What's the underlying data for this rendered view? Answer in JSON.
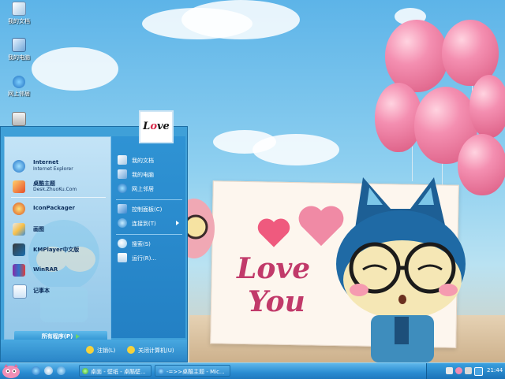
{
  "desktop_icons": [
    {
      "label": "我的文档",
      "icon": "my-documents-icon"
    },
    {
      "label": "我的电脑",
      "icon": "my-computer-icon"
    },
    {
      "label": "网上邻居",
      "icon": "network-icon"
    },
    {
      "label": "",
      "icon": "recycle-bin-icon"
    }
  ],
  "wallpaper": {
    "card_text_line1": "Love",
    "card_text_line2": "You"
  },
  "start_menu": {
    "avatar_text": "Love",
    "pinned": [
      {
        "title": "Internet",
        "subtitle": "Internet Explorer",
        "icon": "ie-icon"
      },
      {
        "title": "桌酷主题",
        "subtitle": "Desk.ZhuoKu.Com",
        "icon": "zhuoku-icon"
      },
      {
        "title": "IconPackager",
        "subtitle": "",
        "icon": "iconpackager-icon"
      },
      {
        "title": "画图",
        "subtitle": "",
        "icon": "paint-icon"
      },
      {
        "title": "KMPlayer中文版",
        "subtitle": "",
        "icon": "kmplayer-icon"
      },
      {
        "title": "WinRAR",
        "subtitle": "",
        "icon": "winrar-icon"
      },
      {
        "title": "记事本",
        "subtitle": "",
        "icon": "notepad-icon"
      }
    ],
    "all_programs": "所有程序(P)",
    "right_items": [
      {
        "label": "我的文档",
        "icon": "my-documents-icon"
      },
      {
        "label": "我的电脑",
        "icon": "my-computer-icon"
      },
      {
        "label": "网上邻居",
        "icon": "network-icon"
      },
      {
        "label": "控制面板(C)",
        "icon": "control-panel-icon"
      },
      {
        "label": "连接到(T)",
        "icon": "connect-icon"
      },
      {
        "label": "搜索(S)",
        "icon": "search-icon"
      },
      {
        "label": "运行(R)...",
        "icon": "run-icon"
      }
    ],
    "logoff": "注销(L)",
    "shutdown": "关闭计算机(U)"
  },
  "taskbar": {
    "tasks": [
      {
        "label": "桌面 - 壁纸 - 桌酷壁...",
        "icon": "browser-icon"
      },
      {
        "label": "-=>>桌酷主题 - Mic...",
        "icon": "browser-icon"
      }
    ],
    "clock": "21:44"
  },
  "colors": {
    "start_menu_blue": "#3fa0d8",
    "taskbar_blue": "#2a8cd2",
    "love_pink": "#c13a6a"
  }
}
